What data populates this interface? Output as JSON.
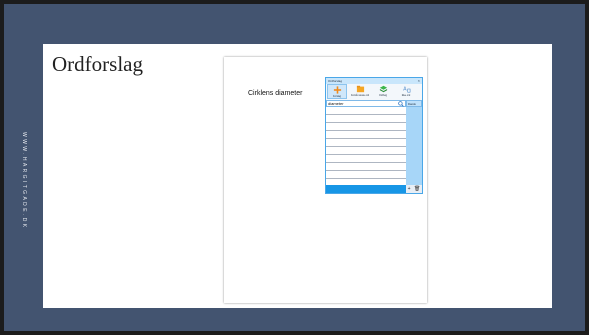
{
  "side_text": "WWW.HARGITGADE.DK",
  "slide": {
    "title": "Ordforslag"
  },
  "document": {
    "text": "Cirklens diameter"
  },
  "app": {
    "window_title": "Ordforslag",
    "close_glyph": "×",
    "toolbar": [
      {
        "label": "Forslag",
        "icon": "plus-icon"
      },
      {
        "label": "Forslå næste ord",
        "icon": "folder-icon"
      },
      {
        "label": "Ordbog",
        "icon": "book-icon"
      },
      {
        "label": "Ikke ord",
        "icon": "text-icon"
      }
    ],
    "search": {
      "value": "diameter"
    },
    "language": "Dansk",
    "list_rows": 10,
    "bottom": {
      "add_glyph": "+",
      "delete_glyph": "🗑"
    },
    "colors": {
      "accent": "#1796e6",
      "panel": "#a7d6f8",
      "border": "#4aa7e8"
    }
  }
}
